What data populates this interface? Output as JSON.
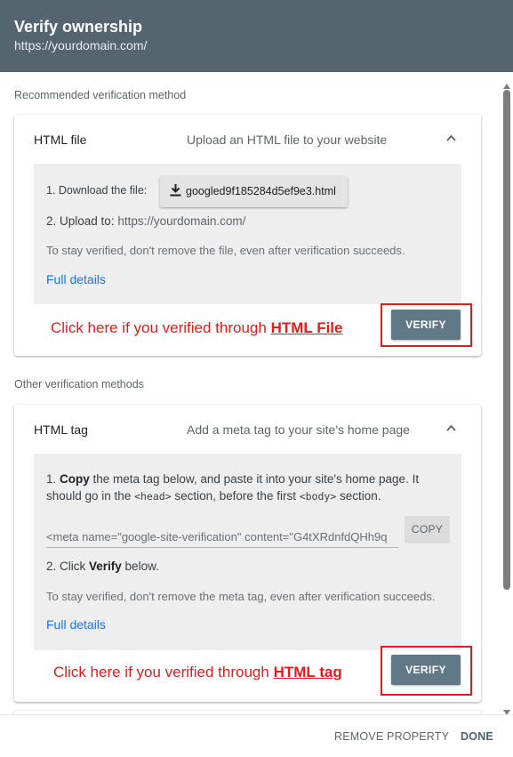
{
  "header": {
    "title": "Verify ownership",
    "subtitle": "https://yourdomain.com/"
  },
  "recommended": {
    "label": "Recommended verification method",
    "card": {
      "title": "HTML file",
      "description": "Upload an HTML file to your website",
      "step1_label": "1. Download the file:",
      "download_filename": "googled9f185284d5ef9e3.html",
      "step2_prefix": "2. Upload to:",
      "step2_url": "https://yourdomain.com/",
      "note": "To stay verified, don't remove the file, even after verification succeeds.",
      "full_details": "Full details",
      "verify_label": "VERIFY",
      "annotation_prefix": "Click here if you verified through",
      "annotation_target": "HTML File"
    }
  },
  "other": {
    "label": "Other verification methods",
    "card": {
      "title": "HTML tag",
      "description": "Add a meta tag to your site's home page",
      "step1_bold": "Copy",
      "step1_a": " the meta tag below, and paste it into your site's home page. It",
      "step1_b": "should go in the ",
      "step1_head": "<head>",
      "step1_c": " section, before the first ",
      "step1_body": "<body>",
      "step1_d": " section.",
      "meta_value": "<meta name=\"google-site-verification\" content=\"G4tXRdnfdQHh9q",
      "copy_label": "COPY",
      "step2_a": "2. Click ",
      "step2_bold": "Verify",
      "step2_b": " below.",
      "note": "To stay verified, don't remove the meta tag, even after verification succeeds.",
      "full_details": "Full details",
      "verify_label": "VERIFY",
      "annotation_prefix": "Click here if you verified through",
      "annotation_target": "HTML tag"
    }
  },
  "footer": {
    "remove_label": "REMOVE PROPERTY",
    "done_label": "DONE"
  },
  "colors": {
    "header_bg": "#546570",
    "verify_bg": "#617986",
    "annotation": "#e01c1c",
    "link": "#1a73e8"
  }
}
